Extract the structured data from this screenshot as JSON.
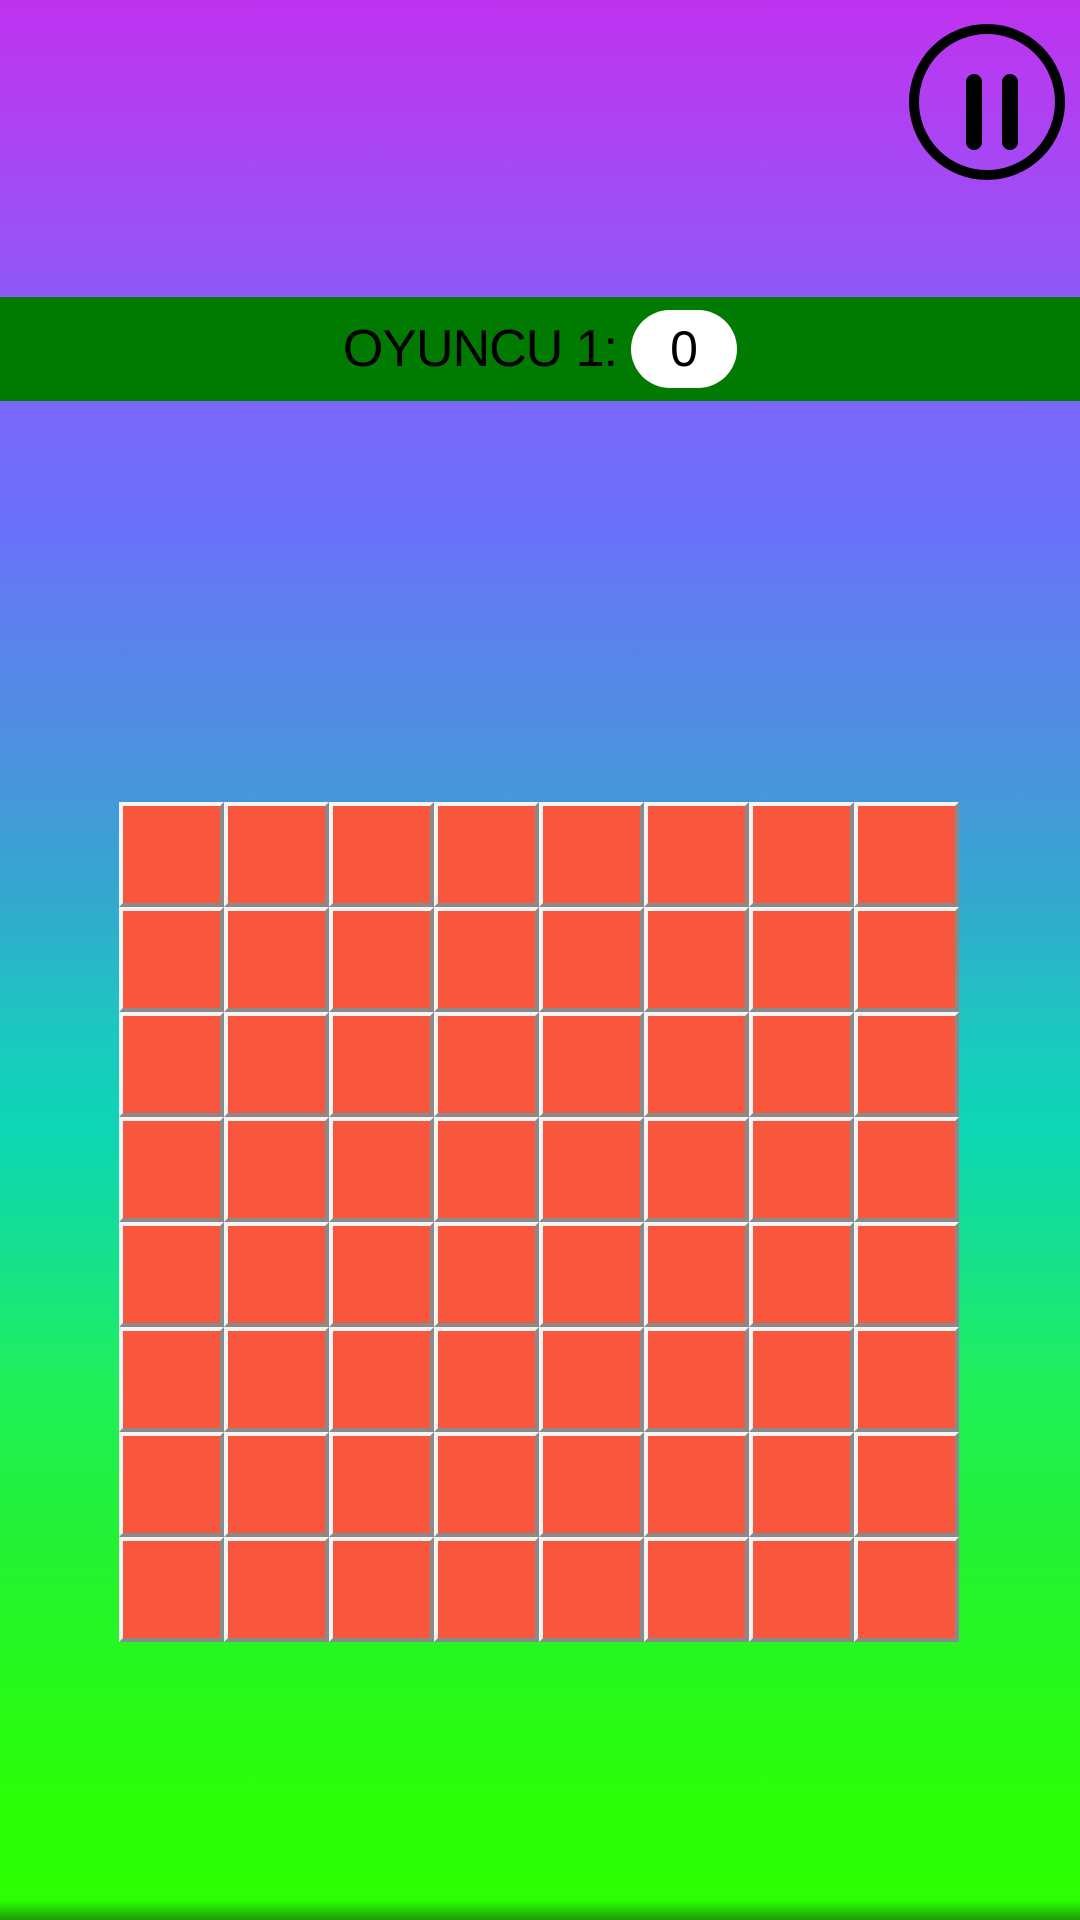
{
  "controls": {
    "pause_icon": "pause-icon"
  },
  "score": {
    "label": "OYUNCU 1:",
    "value": "0"
  },
  "board": {
    "rows": 8,
    "cols": 8,
    "tile_color": "#f8573d"
  },
  "colors": {
    "banner": "#007a00",
    "pill": "#ffffff"
  }
}
